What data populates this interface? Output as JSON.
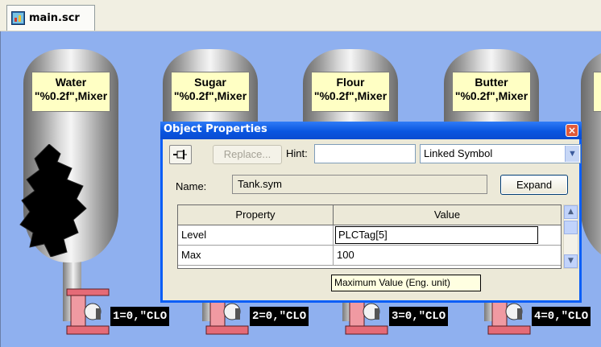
{
  "tab": {
    "label": "main.scr"
  },
  "tanks": [
    {
      "line1": "Water",
      "line2": "\"%0.2f\",Mixer"
    },
    {
      "line1": "Sugar",
      "line2": "\"%0.2f\",Mixer"
    },
    {
      "line1": "Flour",
      "line2": "\"%0.2f\",Mixer"
    },
    {
      "line1": "Butter",
      "line2": "\"%0.2f\",Mixer"
    }
  ],
  "valves": [
    "1=0,\"CLO",
    "2=0,\"CLO",
    "3=0,\"CLO",
    "4=0,\"CLO"
  ],
  "dialog": {
    "title": "Object Properties",
    "close": "×",
    "replace": "Replace...",
    "hint_label": "Hint:",
    "hint_value": "",
    "select_value": "Linked Symbol",
    "name_label": "Name:",
    "name_value": "Tank.sym",
    "expand": "Expand",
    "headers": [
      "Property",
      "Value"
    ],
    "rows": [
      {
        "property": "Level",
        "value": "PLCTag[5]"
      },
      {
        "property": "Max",
        "value": "100"
      }
    ]
  },
  "tooltip": "Maximum Value (Eng. unit)",
  "colors": {
    "canvas": "#8fb0ef",
    "title_blue": "#0a56e0",
    "label_bg": "#ffffc4",
    "valve_red": "#e56b77"
  }
}
